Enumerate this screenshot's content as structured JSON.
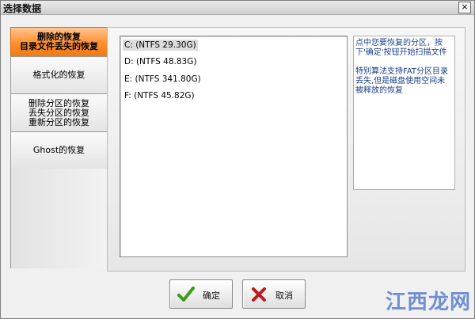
{
  "window": {
    "title": "选择数据",
    "close_glyph": "×"
  },
  "tabs": [
    {
      "lines": [
        "删除的恢复",
        "目录文件丢失的恢复"
      ],
      "active": true
    },
    {
      "lines": [
        "格式化的恢复"
      ],
      "active": false
    },
    {
      "lines": [
        "删除分区的恢复",
        "丢失分区的恢复",
        "重新分区的恢复"
      ],
      "active": false
    },
    {
      "lines": [
        "Ghost的恢复"
      ],
      "active": false
    }
  ],
  "drives": [
    {
      "label": "C:  (NTFS 29.30G)",
      "selected": true
    },
    {
      "label": "D:  (NTFS 48.83G)",
      "selected": false
    },
    {
      "label": "E:  (NTFS 341.80G)",
      "selected": false
    },
    {
      "label": "F:  (NTFS 45.82G)",
      "selected": false
    }
  ],
  "info": {
    "line1": "点中您要恢复的分区，按下'确定'按钮开始扫描文件",
    "line2": "特别算法支持FAT分区目录丢失,但是磁盘使用空间未被释放的恢复"
  },
  "buttons": {
    "ok_label": "确定",
    "cancel_label": "取消"
  },
  "icons": {
    "ok": "check-icon",
    "cancel": "x-icon"
  },
  "colors": {
    "active_tab": "#ff8e2e",
    "info_text": "#1c3f8a",
    "ok_check": "#3a9a1a",
    "cancel_x": "#c01818"
  },
  "watermark": "江西龙网"
}
